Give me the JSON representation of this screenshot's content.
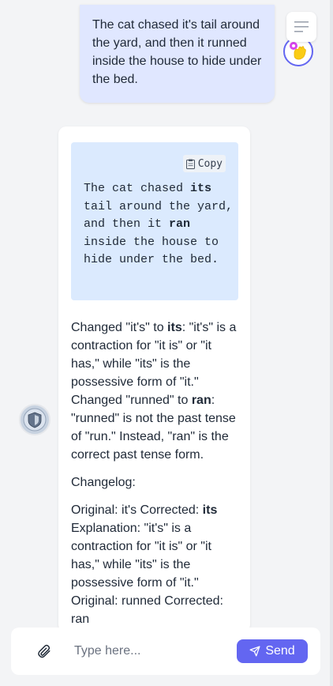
{
  "user_message": {
    "text": "The cat chased it's tail around the yard, and then it runned inside the house to hide under the bed."
  },
  "assistant_message": {
    "code_block": {
      "copy_label": "Copy",
      "parts": [
        "The cat chased ",
        "its",
        " tail around the yard, and then it ",
        "ran",
        " inside the house to hide under the bed."
      ]
    },
    "explanation_1": {
      "a": "Changed \"it's\" to ",
      "b": "its",
      "c": ": \"it's\" is a contraction for \"it is\" or \"it has,\" while \"its\" is the possessive form of \"it.\" Changed \"runned\" to ",
      "d": "ran",
      "e": ": \"runned\" is not the past tense of \"run.\" Instead, \"ran\" is the correct past tense form."
    },
    "changelog_label": "Changelog:",
    "changelog_1": {
      "a": "Original: it's Corrected: ",
      "b": "its",
      "c": " Explanation: \"it's\" is a contraction for \"it is\" or \"it has,\" while \"its\" is the possessive form of \"it.\""
    },
    "changelog_2": {
      "text": "Original: runned Corrected: ran"
    }
  },
  "composer": {
    "placeholder": "Type here...",
    "send_label": "Send"
  },
  "icons": {
    "menu": "hamburger-menu-icon",
    "copy": "clipboard-icon",
    "attach": "paperclip-icon",
    "send": "paper-plane-icon"
  },
  "colors": {
    "accent": "#6366f1",
    "user_bubble": "#e0e7ff",
    "code_block": "#dbeafe",
    "background": "#f3f4f6"
  }
}
